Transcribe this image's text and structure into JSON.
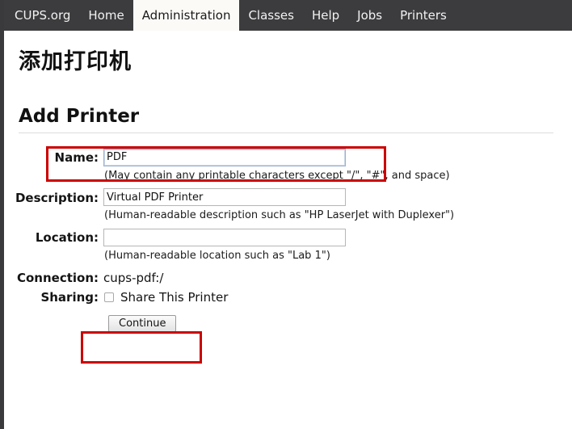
{
  "nav": {
    "items": [
      {
        "label": "CUPS.org",
        "active": false,
        "name": "nav-item-cups-org"
      },
      {
        "label": "Home",
        "active": false,
        "name": "nav-item-home"
      },
      {
        "label": "Administration",
        "active": true,
        "name": "nav-item-administration"
      },
      {
        "label": "Classes",
        "active": false,
        "name": "nav-item-classes"
      },
      {
        "label": "Help",
        "active": false,
        "name": "nav-item-help"
      },
      {
        "label": "Jobs",
        "active": false,
        "name": "nav-item-jobs"
      },
      {
        "label": "Printers",
        "active": false,
        "name": "nav-item-printers"
      }
    ]
  },
  "page": {
    "title": "添加打印机",
    "heading": "Add Printer"
  },
  "form": {
    "name": {
      "label": "Name:",
      "value": "PDF",
      "placeholder": "",
      "hint": "(May contain any printable characters except \"/\", \"#\", and space)"
    },
    "description": {
      "label": "Description:",
      "value": "Virtual PDF Printer",
      "placeholder": "",
      "hint": "(Human-readable description such as \"HP LaserJet with Duplexer\")"
    },
    "location": {
      "label": "Location:",
      "value": "",
      "placeholder": "",
      "hint": "(Human-readable location such as \"Lab 1\")"
    },
    "connection": {
      "label": "Connection:",
      "value": "cups-pdf:/"
    },
    "sharing": {
      "label": "Sharing:",
      "checkbox_label": "Share This Printer",
      "checked": false
    },
    "submit": {
      "label": "Continue"
    }
  },
  "annotations": {
    "color": "#cc0000",
    "boxes": [
      {
        "target": "name-row",
        "name": "annotation-box-name"
      },
      {
        "target": "continue-button",
        "name": "annotation-box-continue"
      }
    ]
  },
  "theme": {
    "navbar_background": "#3c3c3e",
    "navbar_active_background": "#fbfaf7",
    "page_background": "#ffffff",
    "focus_border": "#9aaed0"
  }
}
